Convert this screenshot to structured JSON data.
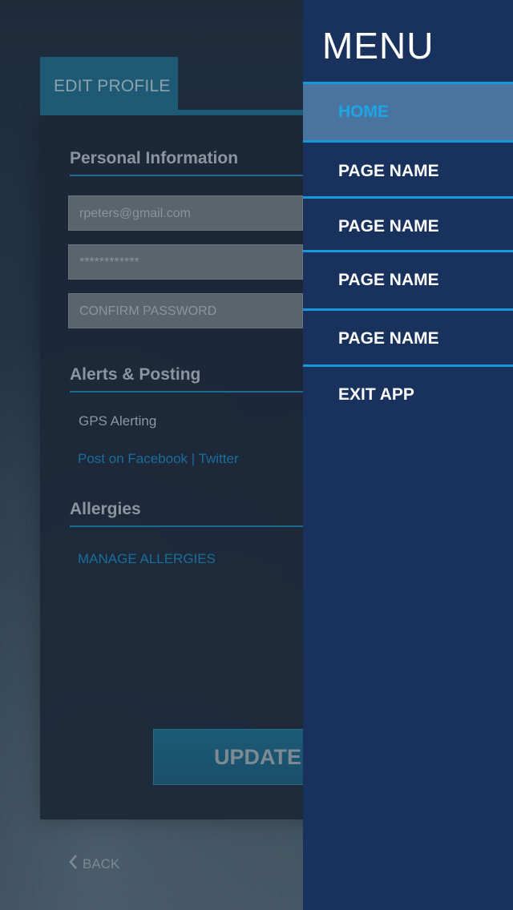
{
  "profile": {
    "tab_label": "EDIT PROFILE",
    "personal_title": "Personal Information",
    "email_value": "rpeters@gmail.com",
    "password_value": "************",
    "confirm_placeholder": "CONFIRM PASSWORD",
    "alerts_title": "Alerts & Posting",
    "gps_label": "GPS Alerting",
    "post_label": "Post on Facebook | Twitter",
    "allergies_title": "Allergies",
    "manage_allergies": "MANAGE ALLERGIES",
    "update_label": "UPDATE",
    "back_label": "BACK"
  },
  "menu": {
    "title": "MENU",
    "items": [
      {
        "label": "HOME",
        "active": true
      },
      {
        "label": "PAGE NAME",
        "active": false
      },
      {
        "label": "PAGE NAME",
        "active": false
      },
      {
        "label": "PAGE NAME",
        "active": false
      },
      {
        "label": "PAGE NAME",
        "active": false
      },
      {
        "label": "EXIT APP",
        "active": false
      }
    ]
  },
  "colors": {
    "menu_bg": "#18315d",
    "accent": "#1898d8",
    "active_item_bg": "#4a74a0",
    "panel_tab": "#1f5a74"
  },
  "icons": {
    "back": "chevron-left-icon"
  }
}
